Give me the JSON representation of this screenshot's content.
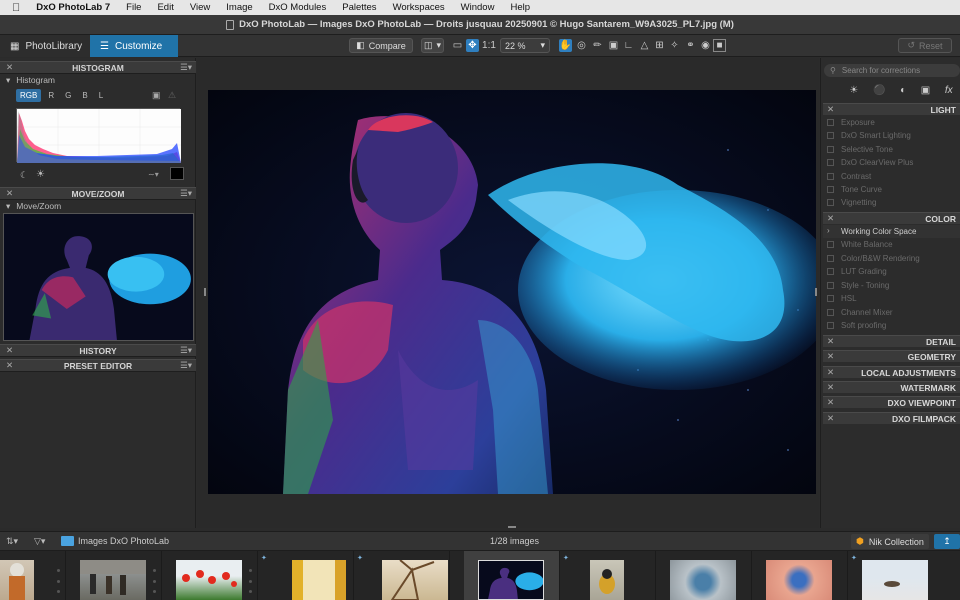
{
  "menubar": {
    "app": "DxO PhotoLab 7",
    "items": [
      "File",
      "Edit",
      "View",
      "Image",
      "DxO Modules",
      "Palettes",
      "Workspaces",
      "Window",
      "Help"
    ]
  },
  "window": {
    "title": "DxO PhotoLab — Images DxO PhotoLab — Droits jusquau 20250901 © Hugo Santarem_W9A3025_PL7.jpg (M)"
  },
  "toolbar": {
    "tab_library": "PhotoLibrary",
    "tab_customize": "Customize",
    "compare_label": "Compare",
    "one_to_one": "1:1",
    "zoom_value": "22 %",
    "reset_label": "Reset"
  },
  "left_panel": {
    "histogram": {
      "title": "HISTOGRAM",
      "sub": "Histogram",
      "channels": [
        "RGB",
        "R",
        "G",
        "B",
        "L"
      ],
      "selected": "RGB"
    },
    "movezoom": {
      "title": "MOVE/ZOOM",
      "sub": "Move/Zoom"
    },
    "history": {
      "title": "HISTORY"
    },
    "preset_editor": {
      "title": "PRESET EDITOR"
    }
  },
  "right_panel": {
    "search_placeholder": "Search for corrections",
    "light": {
      "title": "LIGHT",
      "items": [
        "Exposure",
        "DxO Smart Lighting",
        "Selective Tone",
        "DxO ClearView Plus",
        "Contrast",
        "Tone Curve",
        "Vignetting"
      ]
    },
    "color": {
      "title": "COLOR",
      "items": [
        "Working Color Space",
        "White Balance",
        "Color/B&W Rendering",
        "LUT Grading",
        "Style - Toning",
        "HSL",
        "Channel Mixer",
        "Soft proofing"
      ]
    },
    "sections": [
      "DETAIL",
      "GEOMETRY",
      "LOCAL ADJUSTMENTS",
      "WATERMARK",
      "DXO VIEWPOINT",
      "DXO FILMPACK"
    ]
  },
  "filmstrip_bar": {
    "folder": "Images DxO PhotoLab",
    "count": "1/28 images",
    "nik": "Nik Collection"
  },
  "colors": {
    "accent": "#2073a8",
    "active_tool": "#2f7fbf"
  }
}
